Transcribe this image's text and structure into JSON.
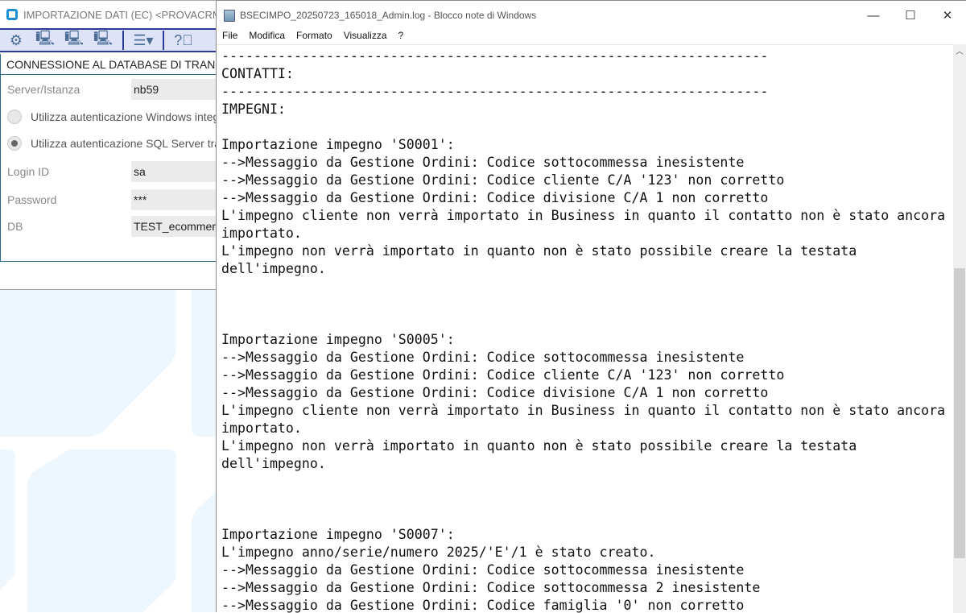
{
  "app": {
    "title": "IMPORTAZIONE DATI (EC) <PROVACRM - AZI",
    "panel_title": "CONNESSIONE AL DATABASE DI TRANSIZIONE",
    "fields": {
      "server_label": "Server/Istanza",
      "server_value": "nb59",
      "win_auth": "Utilizza autenticazione Windows integrata",
      "sql_auth": "Utilizza autenticazione SQL Server tramite",
      "login_label": "Login ID",
      "login_value": "sa",
      "password_label": "Password",
      "password_value": "***",
      "db_label": "DB",
      "db_value": "TEST_ecommerce"
    }
  },
  "notepad": {
    "title": "BSECIMPO_20250723_165018_Admin.log - Blocco note di Windows",
    "menu": [
      "File",
      "Modifica",
      "Formato",
      "Visualizza",
      "?"
    ],
    "lines": [
      "--------------------------------------------------------------------",
      "CONTATTI:",
      "--------------------------------------------------------------------",
      "IMPEGNI:",
      "",
      "Importazione impegno 'S0001':",
      "-->Messaggio da Gestione Ordini: Codice sottocommessa inesistente",
      "-->Messaggio da Gestione Ordini: Codice cliente C/A '123' non corretto",
      "-->Messaggio da Gestione Ordini: Codice divisione C/A 1 non corretto",
      "L'impegno cliente non verrà importato in Business in quanto il contatto non è stato ancora",
      "importato.",
      "L'impegno non verrà importato in quanto non è stato possibile creare la testata",
      "dell'impegno.",
      "",
      "",
      "",
      "Importazione impegno 'S0005':",
      "-->Messaggio da Gestione Ordini: Codice sottocommessa inesistente",
      "-->Messaggio da Gestione Ordini: Codice cliente C/A '123' non corretto",
      "-->Messaggio da Gestione Ordini: Codice divisione C/A 1 non corretto",
      "L'impegno cliente non verrà importato in Business in quanto il contatto non è stato ancora",
      "importato.",
      "L'impegno non verrà importato in quanto non è stato possibile creare la testata",
      "dell'impegno.",
      "",
      "",
      "",
      "Importazione impegno 'S0007':",
      "L'impegno anno/serie/numero 2025/'E'/1 è stato creato.",
      "-->Messaggio da Gestione Ordini: Codice sottocommessa inesistente",
      "-->Messaggio da Gestione Ordini: Codice sottocommessa 2 inesistente",
      "-->Messaggio da Gestione Ordini: Codice famiglia '0' non corretto"
    ],
    "scroll_position": 0.45
  }
}
